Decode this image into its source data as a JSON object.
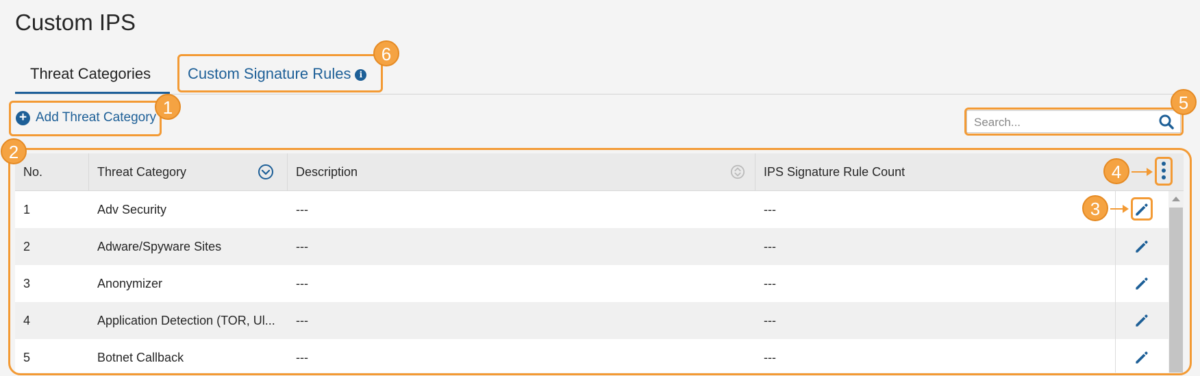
{
  "page": {
    "title": "Custom IPS"
  },
  "tabs": [
    {
      "label": "Threat Categories",
      "active": true
    },
    {
      "label": "Custom Signature Rules",
      "active": false
    }
  ],
  "actions": {
    "add_label": "Add Threat Category"
  },
  "search": {
    "placeholder": "Search..."
  },
  "table": {
    "columns": [
      "No.",
      "Threat Category",
      "Description",
      "IPS Signature Rule Count"
    ],
    "rows": [
      {
        "no": "1",
        "category": "Adv Security",
        "description": "---",
        "count": "---"
      },
      {
        "no": "2",
        "category": "Adware/Spyware Sites",
        "description": "---",
        "count": "---"
      },
      {
        "no": "3",
        "category": "Anonymizer",
        "description": "---",
        "count": "---"
      },
      {
        "no": "4",
        "category": "Application Detection (TOR, Ul...",
        "description": "---",
        "count": "---"
      },
      {
        "no": "5",
        "category": "Botnet Callback",
        "description": "---",
        "count": "---"
      }
    ]
  },
  "callouts": [
    "1",
    "2",
    "3",
    "4",
    "5",
    "6"
  ],
  "colors": {
    "accent": "#1d5f97",
    "callout": "#f39a34",
    "background": "#f4f4f4"
  },
  "icons": [
    "info-icon",
    "plus-circle-icon",
    "search-icon",
    "sort-circle-icon",
    "kebab-menu-icon",
    "pencil-edit-icon",
    "scroll-up-icon"
  ]
}
